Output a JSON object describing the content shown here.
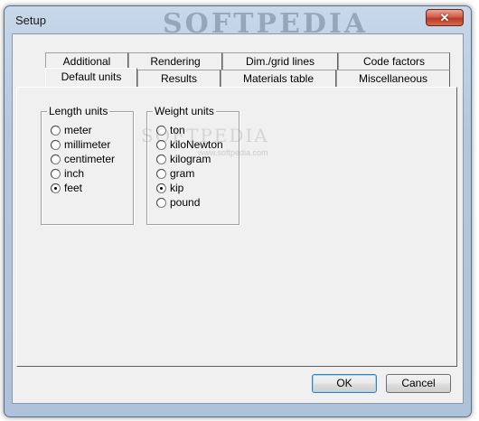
{
  "window": {
    "title": "Setup",
    "watermark": "SOFTPEDIA",
    "close_glyph": "✕"
  },
  "tabs": {
    "row1": [
      {
        "label": "Additional"
      },
      {
        "label": "Rendering"
      },
      {
        "label": "Dim./grid lines"
      },
      {
        "label": "Code factors"
      }
    ],
    "row2": [
      {
        "label": "Default units",
        "active": true
      },
      {
        "label": "Results"
      },
      {
        "label": "Materials table"
      },
      {
        "label": "Miscellaneous"
      }
    ]
  },
  "length_units": {
    "legend": "Length units",
    "options": [
      "meter",
      "millimeter",
      "centimeter",
      "inch",
      "feet"
    ],
    "selected": "feet"
  },
  "weight_units": {
    "legend": "Weight units",
    "options": [
      "ton",
      "kiloNewton",
      "kilogram",
      "gram",
      "kip",
      "pound"
    ],
    "selected": "kip"
  },
  "buttons": {
    "ok": "OK",
    "cancel": "Cancel"
  },
  "faint_watermark": "SOFTPEDIA",
  "faint_watermark_sub": "www.softpedia.com"
}
